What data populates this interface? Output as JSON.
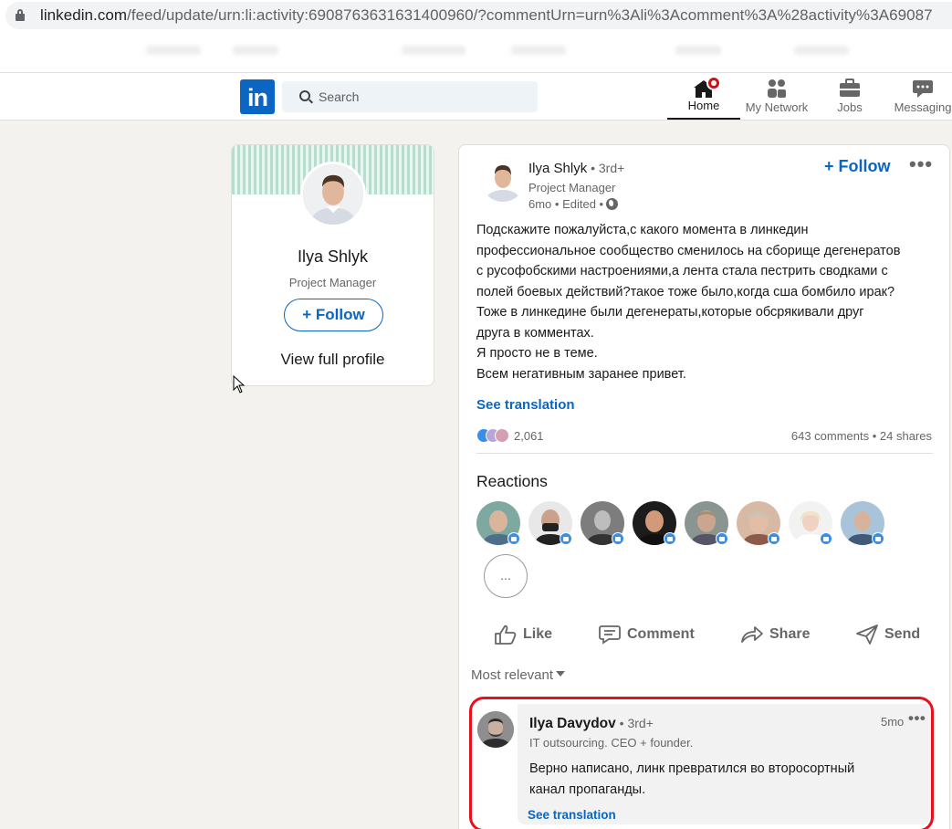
{
  "browser": {
    "url_host": "linkedin.com",
    "url_path": "/feed/update/urn:li:activity:6908763631631400960/?commentUrn=urn%3Ali%3Acomment%3A%28activity%3A69087"
  },
  "header": {
    "logo_text": "in",
    "search_placeholder": "Search",
    "nav": {
      "home": "Home",
      "network": "My Network",
      "jobs": "Jobs",
      "messaging": "Messaging"
    }
  },
  "profile_card": {
    "name": "Ilya Shlyk",
    "title": "Project Manager",
    "follow_label": "+ Follow",
    "view_profile": "View full profile"
  },
  "post": {
    "author": "Ilya Shlyk",
    "degree": " • 3rd+",
    "title": "Project Manager",
    "meta": "6mo • Edited •",
    "follow_label": "+ Follow",
    "more_label": "•••",
    "body_lines": [
      "Подскажите пожалуйста,с какого момента в линкедин",
      "профессиональное сообщество сменилось на сборище дегенератов",
      "с русофобскими настроениями,а лента стала пестрить сводками с",
      "полей боевых действий?такое тоже было,когда сша бомбило ирак?",
      "Тоже в линкедине были дегенераты,которые обсрякивали друг",
      "друга в комментах.",
      "Я просто не в теме.",
      "Всем негативным заранее привет."
    ],
    "see_translation": "See translation",
    "reaction_count": "2,061",
    "stats": "643 comments • 24 shares",
    "reactions_heading": "Reactions",
    "more_reactions": "...",
    "actions": {
      "like": "Like",
      "comment": "Comment",
      "share": "Share",
      "send": "Send"
    },
    "sort_label": "Most relevant"
  },
  "comment": {
    "author": "Ilya Davydov",
    "degree": " • 3rd+",
    "title": "IT outsourcing. CEO + founder.",
    "time": "5mo",
    "more_label": "•••",
    "text_lines": [
      "Верно написано, линк превратился во второсортный",
      "канал пропаганды."
    ],
    "see_translation": "See translation"
  },
  "colors": {
    "brand": "#0a66c2",
    "highlight": "#e8101c",
    "notification": "#cc1016"
  }
}
